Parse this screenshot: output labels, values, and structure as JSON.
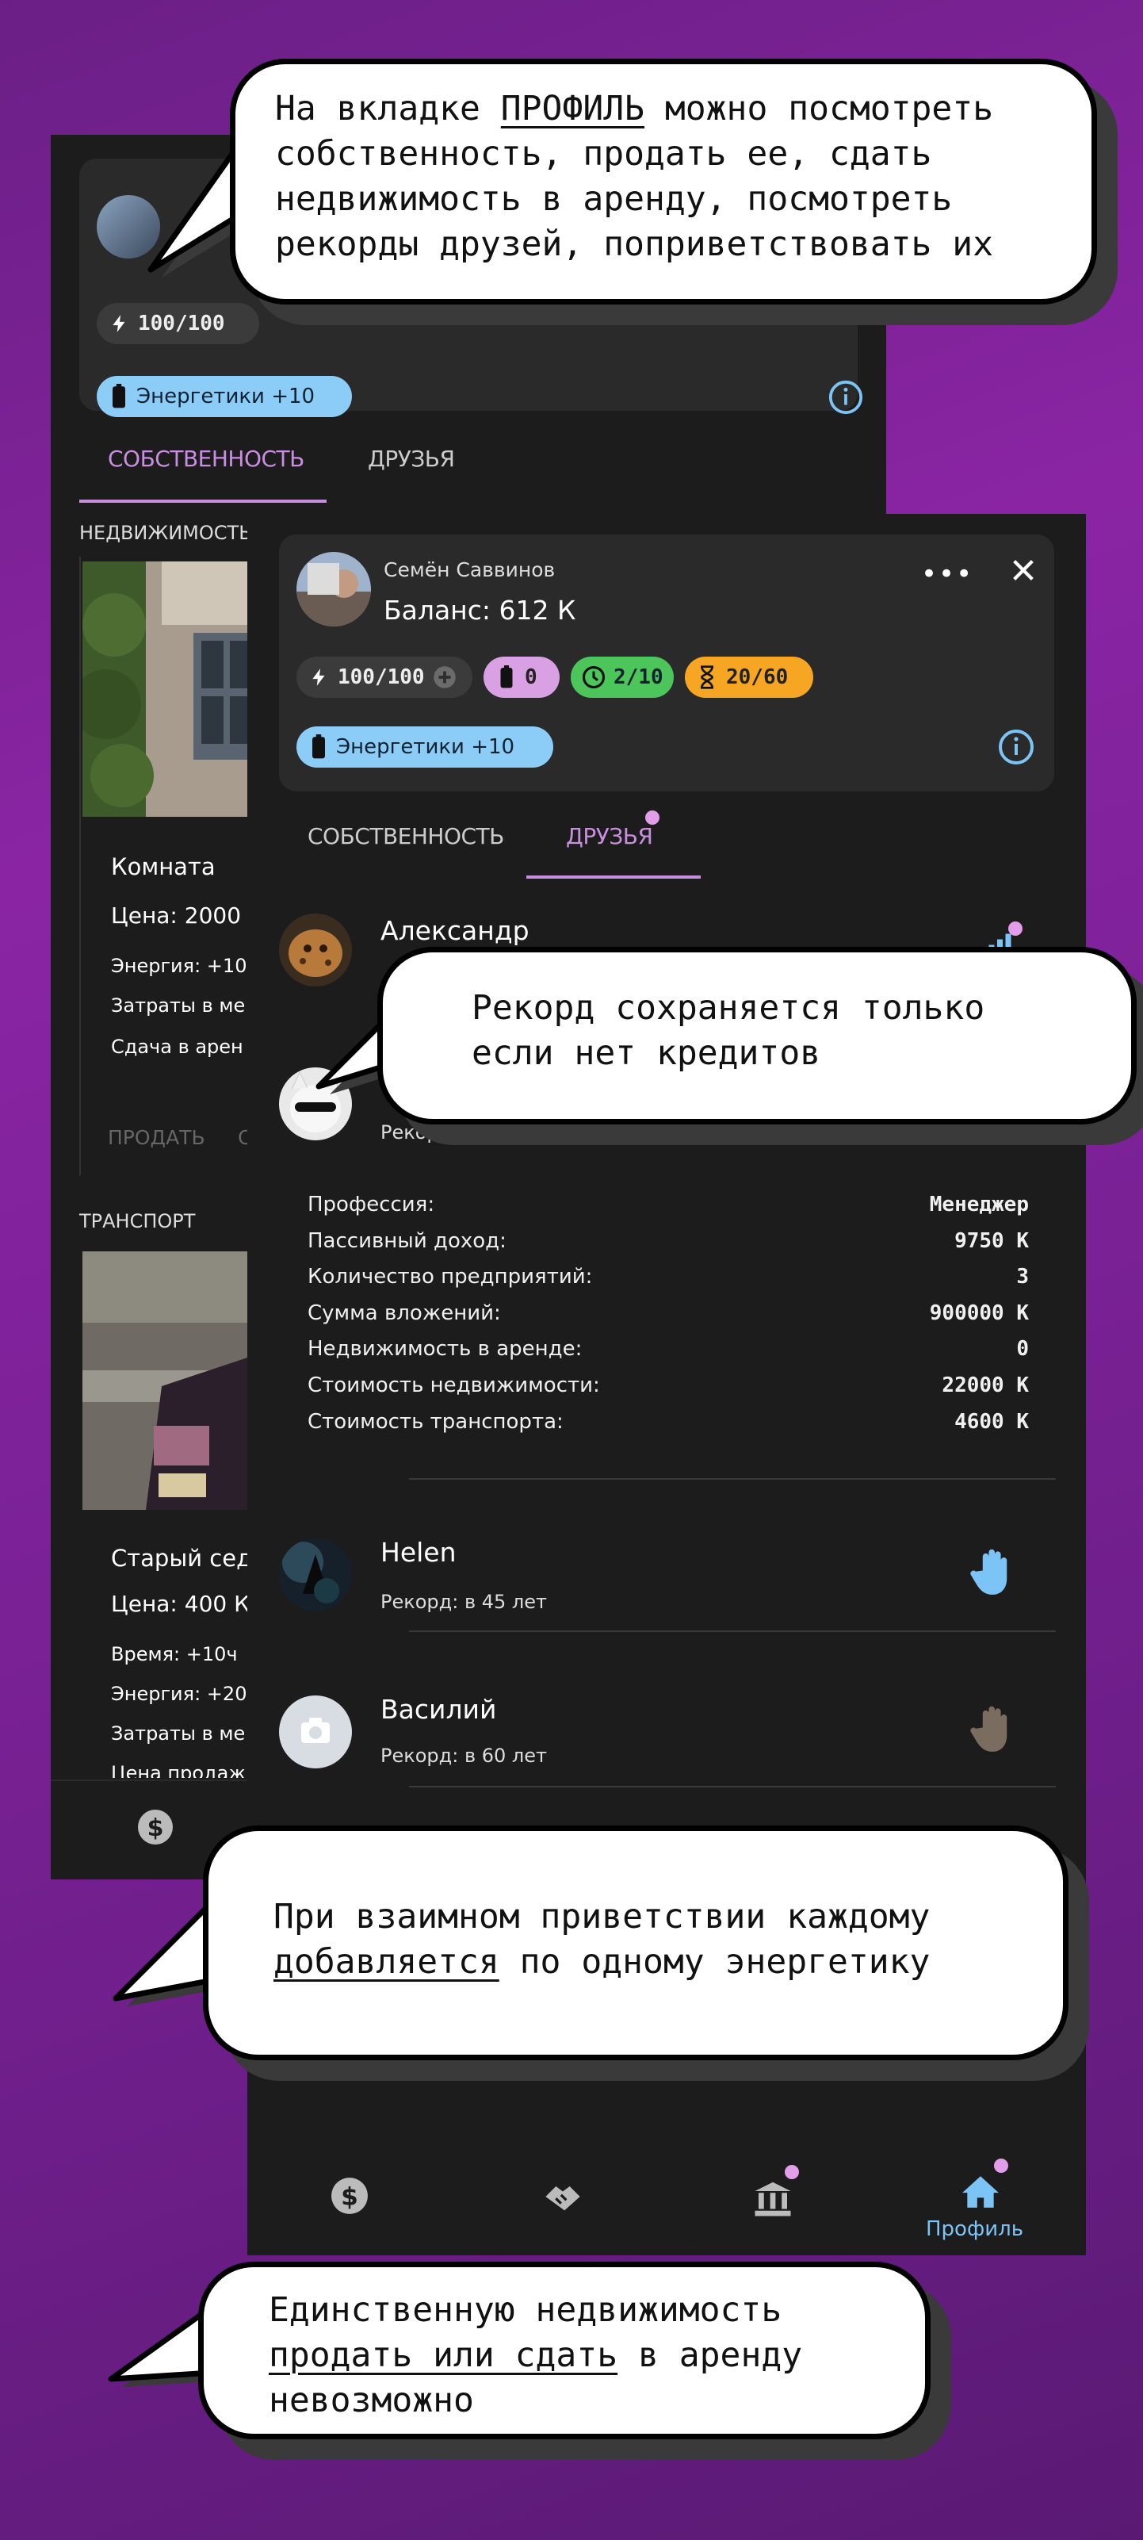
{
  "colors": {
    "accent": "#c98ee0",
    "blue": "#7cc4f5",
    "green": "#4cc55b",
    "orange": "#f6a623",
    "purple_chip": "#d9a0e4"
  },
  "callouts": {
    "c1": {
      "pre": "На вкладке ",
      "link": "ПРОФИЛЬ",
      "post": " можно посмотреть\nсобственность, продать ее, сдать\nнедвижимость в аренду, посмотреть\nрекорды друзей, поприветствовать их"
    },
    "c2": {
      "text": "Рекорд сохраняется только\nесли нет кредитов"
    },
    "c3": {
      "line1": "При взаимном приветствии каждому",
      "link": "добавляется",
      "post": " по одному энергетику"
    },
    "c4": {
      "line1": "Единственную недвижимость",
      "link": "продать или сдать",
      "post": " в аренду",
      "line3": "невозможно"
    }
  },
  "back": {
    "energy": "100/100",
    "energetics": "Энергетики +10",
    "tabs": {
      "property": "СОБСТВЕННОСТЬ",
      "friends": "ДРУЗЬЯ"
    },
    "sections": {
      "realty": "НЕДВИЖИМОСТЬ",
      "transport": "ТРАНСПОРТ"
    },
    "realty_card": {
      "title": "Комната",
      "price": "Цена: 2000",
      "energy": "Энергия: +10",
      "costs": "Затраты в ме",
      "rent": "Сдача в арен",
      "sell": "ПРОДАТЬ",
      "rent_btn": "С"
    },
    "transport_card": {
      "title": "Старый сед",
      "price": "Цена: 400 К",
      "time": "Время: +10ч",
      "energy": "Энергия: +20",
      "costs": "Затраты в ме",
      "sale": "Цена продаж"
    }
  },
  "front": {
    "profile": {
      "name": "Семён Саввинов",
      "balance": "Баланс: 612 К"
    },
    "chips": {
      "energy": "100/100",
      "battery": "0",
      "clock": "2/10",
      "hourglass": "20/60",
      "energetics": "Энергетики +10"
    },
    "tabs": {
      "property": "СОБСТВЕННОСТЬ",
      "friends": "ДРУЗЬЯ"
    },
    "friends": [
      {
        "name": "Александр",
        "record": ""
      },
      {
        "name": "",
        "record": "Рекорд: в 80 лет"
      },
      {
        "name": "Helen",
        "record": "Рекорд: в 45 лет"
      },
      {
        "name": "Василий",
        "record": "Рекорд: в 60 лет"
      }
    ],
    "stats": [
      {
        "label": "Профессия:",
        "value": "Менеджер"
      },
      {
        "label": "Пассивный доход:",
        "value": "9750 К"
      },
      {
        "label": "Количество предприятий:",
        "value": "3"
      },
      {
        "label": "Сумма вложений:",
        "value": "900000 К"
      },
      {
        "label": "Недвижимость в аренде:",
        "value": "0"
      },
      {
        "label": "Стоимость недвижимости:",
        "value": "22000 К"
      },
      {
        "label": "Стоимость транспорта:",
        "value": "4600 К"
      }
    ],
    "nav": {
      "profile": "Профиль"
    }
  }
}
